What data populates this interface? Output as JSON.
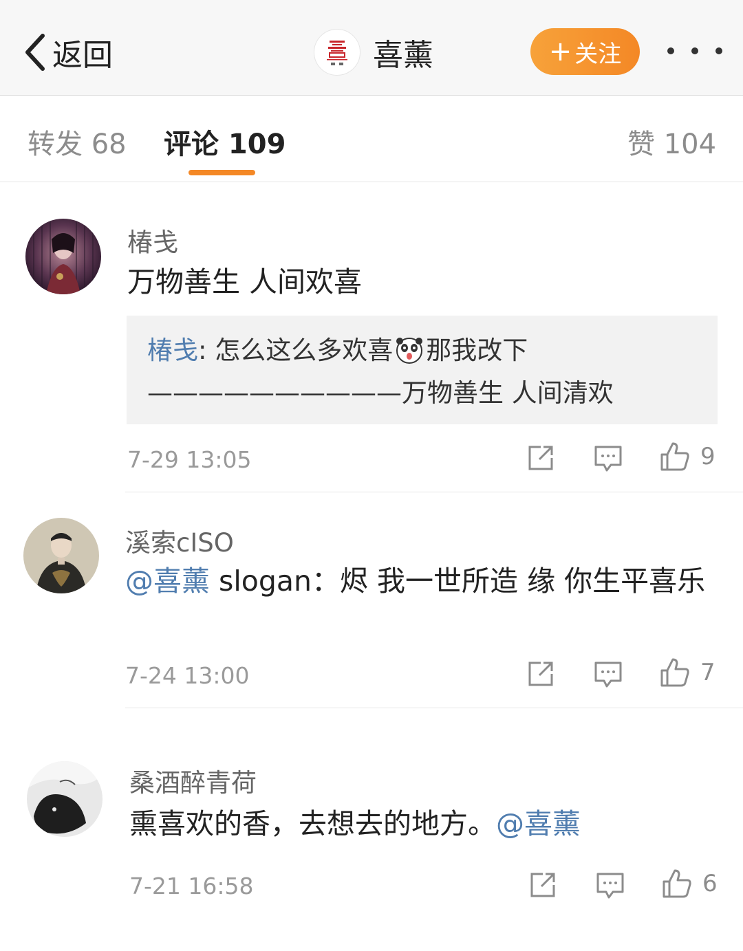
{
  "header": {
    "back_label": "返回",
    "account_name": "喜薰",
    "follow_label": "关注",
    "follow_plus": "+",
    "accent": "#f48826"
  },
  "tabs": [
    {
      "label": "转发 68"
    },
    {
      "label": "评论 109",
      "active": true
    },
    {
      "label": "赞 104"
    }
  ],
  "comments": [
    {
      "user": "椿戋",
      "text": "万物善生 人间欢喜",
      "quote": {
        "user": "椿戋",
        "line1": "怎么这么多欢喜",
        "line1_after": "那我改下",
        "line2": "——————————万物善生 人间清欢",
        "emoji": "panda-emoji"
      },
      "time": "7-29 13:05",
      "likes": "9"
    },
    {
      "user": "溪索cISO",
      "mention": "@喜薰",
      "text": " slogan：烬 我一世所造  缘 你生平喜乐",
      "time": "7-24 13:00",
      "likes": "7"
    },
    {
      "user": "桑酒醉青荷",
      "text": "熏喜欢的香，去想去的地方。",
      "mention": "@喜薰",
      "time": "7-21 16:58",
      "likes": "6"
    }
  ],
  "colors": {
    "link": "#507daf",
    "muted": "#9a9a9a"
  }
}
